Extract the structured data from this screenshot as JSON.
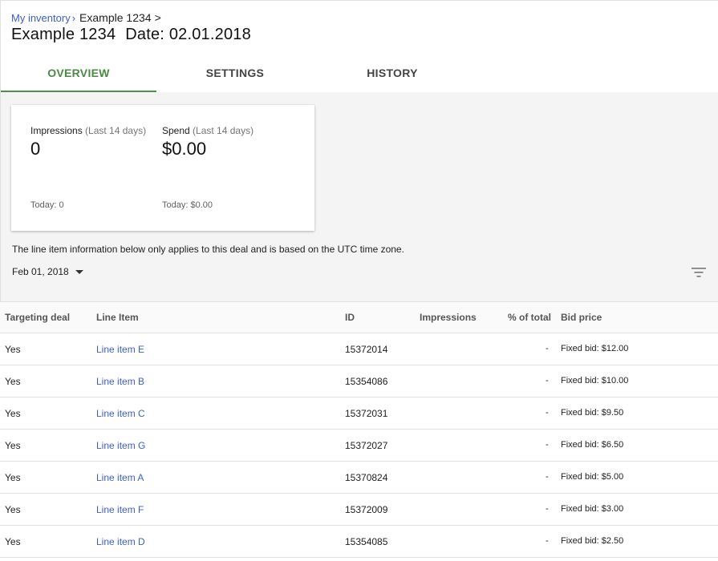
{
  "breadcrumb": {
    "parent_label": "My inventory",
    "parent_sep": "›",
    "current_label": "Example 1234",
    "current_sep": ">"
  },
  "page": {
    "name": "Example 1234",
    "date_label": "Date: 02.01.2018"
  },
  "tabs": [
    {
      "label": "OVERVIEW",
      "active": true
    },
    {
      "label": "SETTINGS",
      "active": false
    },
    {
      "label": "HISTORY",
      "active": false
    }
  ],
  "summary": {
    "impressions": {
      "label": "Impressions",
      "period": "(Last 14 days)",
      "value": "0",
      "today": "Today: 0"
    },
    "spend": {
      "label": "Spend",
      "period": "(Last 14 days)",
      "value": "$0.00",
      "today": "Today: $0.00"
    }
  },
  "info_text": "The line item information below only applies to this deal and is based on the UTC time zone.",
  "date_filter": {
    "value": "Feb 01, 2018"
  },
  "icons": {
    "filter": "filter-list-icon",
    "dropdown": "arrow-drop-down-icon"
  },
  "colors": {
    "accent_green": "#4a9446",
    "link_blue": "#3c5fc7",
    "panel_bg": "#f4f4f4"
  },
  "table": {
    "headers": [
      "Targeting deal",
      "Line Item",
      "ID",
      "Impressions",
      "% of total",
      "Bid price"
    ],
    "rows": [
      {
        "targeting": "Yes",
        "line_item": "Line item E",
        "id": "15372014",
        "impressions": "",
        "pct": "-",
        "bid": "Fixed bid: $12.00"
      },
      {
        "targeting": "Yes",
        "line_item": "Line item B",
        "id": "15354086",
        "impressions": "",
        "pct": "-",
        "bid": "Fixed bid: $10.00"
      },
      {
        "targeting": "Yes",
        "line_item": "Line item C",
        "id": "15372031",
        "impressions": "",
        "pct": "-",
        "bid": "Fixed bid: $9.50"
      },
      {
        "targeting": "Yes",
        "line_item": "Line item G",
        "id": "15372027",
        "impressions": "",
        "pct": "-",
        "bid": "Fixed bid: $6.50"
      },
      {
        "targeting": "Yes",
        "line_item": "Line item A",
        "id": "15370824",
        "impressions": "",
        "pct": "-",
        "bid": "Fixed bid: $5.00"
      },
      {
        "targeting": "Yes",
        "line_item": "Line item F",
        "id": "15372009",
        "impressions": "",
        "pct": "-",
        "bid": "Fixed bid: $3.00"
      },
      {
        "targeting": "Yes",
        "line_item": "Line item D",
        "id": "15354085",
        "impressions": "",
        "pct": "-",
        "bid": "Fixed bid: $2.50"
      }
    ]
  }
}
